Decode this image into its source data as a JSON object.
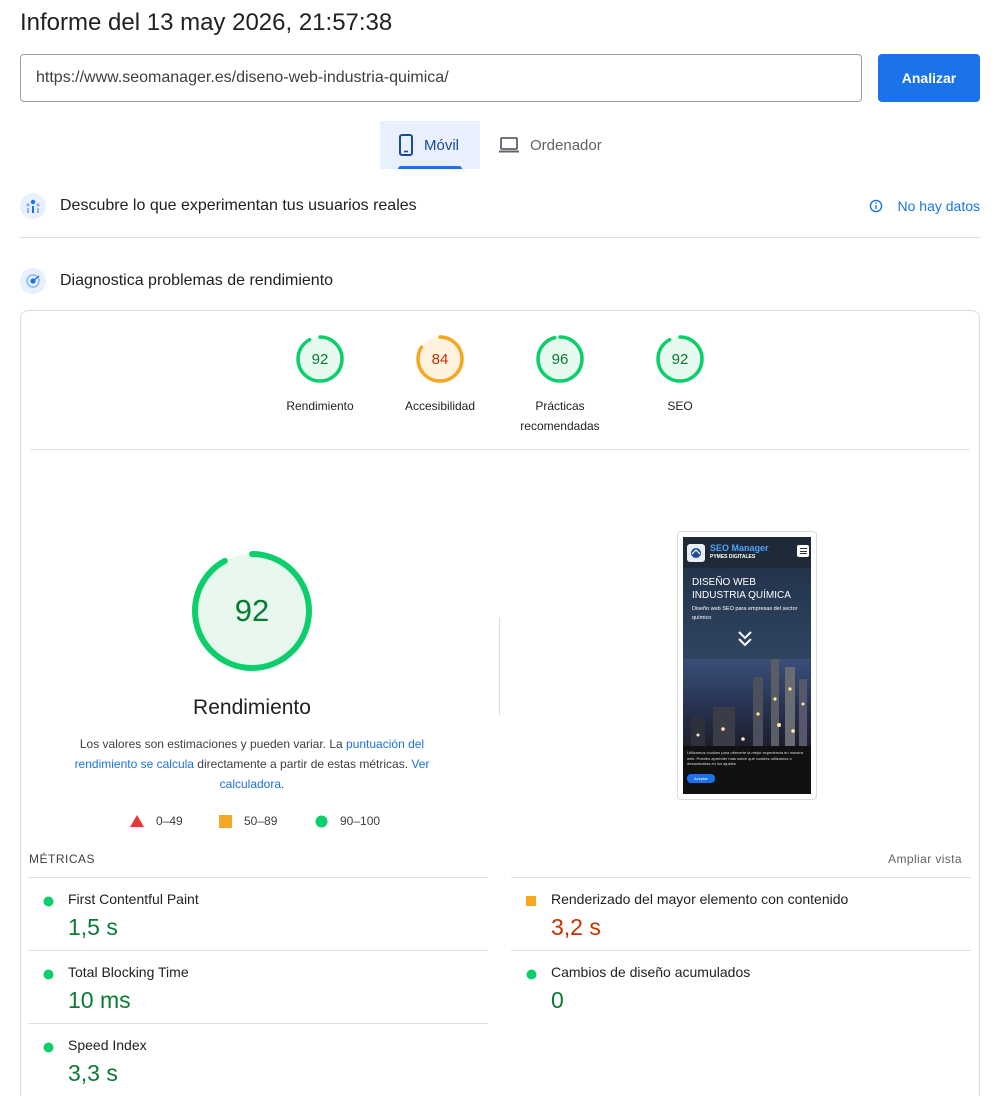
{
  "report_title": "Informe del 13 may 2026, 21:57:38",
  "url_input": {
    "value": "https://www.seomanager.es/diseno-web-industria-quimica/"
  },
  "analyze_button": "Analizar",
  "tabs": [
    {
      "label": "Móvil",
      "selected": true,
      "icon": "smartphone-icon"
    },
    {
      "label": "Ordenador",
      "selected": false,
      "icon": "laptop-icon"
    }
  ],
  "sections": {
    "real_users": {
      "title": "Descubre lo que experimentan tus usuarios reales",
      "status": "No hay datos",
      "icon": "users-chart-icon"
    },
    "diagnostics": {
      "title": "Diagnostica problemas de rendimiento",
      "icon": "lighthouse-icon"
    }
  },
  "scores": [
    {
      "value": "92",
      "label": "Rendimiento",
      "level": "pass"
    },
    {
      "value": "84",
      "label": "Accesibilidad",
      "level": "average"
    },
    {
      "value": "96",
      "label": "Prácticas recomendadas",
      "level": "pass"
    },
    {
      "value": "92",
      "label": "SEO",
      "level": "pass"
    }
  ],
  "performance": {
    "score": "92",
    "title": "Rendimiento",
    "desc_1": "Los valores son estimaciones y pueden variar. La ",
    "link_1": "puntuación del rendimiento se calcula",
    "desc_2": " directamente a partir de estas métricas. ",
    "link_2": "Ver calculadora",
    "desc_3": "."
  },
  "legend": [
    {
      "range": "0–49",
      "shape": "triangle",
      "color": "#e53935"
    },
    {
      "range": "50–89",
      "shape": "square",
      "color": "#f5a623"
    },
    {
      "range": "90–100",
      "shape": "circle",
      "color": "#0cce6b"
    }
  ],
  "screenshot": {
    "brand": "SEO Manager",
    "brand_sub": "PYMES DIGITALES",
    "heading": "DISEÑO WEB INDUSTRIA QUÍMICA",
    "subheading": "Diseño web SEO para empresas del sector químico",
    "cookie_text": "Utilizamos cookies para ofrecerte la mejor experiencia en nuestra web. Puedes aprender más sobre qué cookies utilizamos o desactivarlas en los ajustes",
    "cookie_button": "Aceptar"
  },
  "metrics_header": {
    "label": "MÉTRICAS",
    "expand": "Ampliar vista"
  },
  "metrics": [
    {
      "name": "First Contentful Paint",
      "value": "1,5 s",
      "level": "pass"
    },
    {
      "name": "Renderizado del mayor elemento con contenido",
      "value": "3,2 s",
      "level": "average"
    },
    {
      "name": "Total Blocking Time",
      "value": "10 ms",
      "level": "pass"
    },
    {
      "name": "Cambios de diseño acumulados",
      "value": "0",
      "level": "pass"
    },
    {
      "name": "Speed Index",
      "value": "3,3 s",
      "level": "pass"
    }
  ],
  "colors": {
    "pass": "#0cce6b",
    "pass_text": "#0a7a34",
    "average": "#f5a623",
    "average_text": "#c33300",
    "accent": "#1a73e8"
  }
}
